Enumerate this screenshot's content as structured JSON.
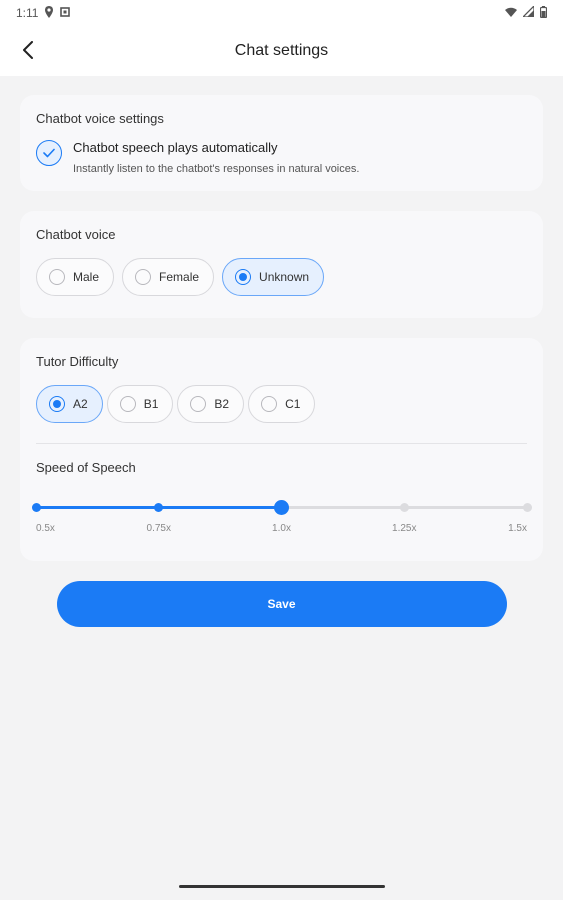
{
  "status_bar": {
    "time": "1:11",
    "icons": [
      "location-icon",
      "notification-icon",
      "wifi-icon",
      "signal-icon",
      "battery-icon"
    ]
  },
  "app_bar": {
    "title": "Chat settings",
    "back_icon": "back-arrow-icon"
  },
  "voice_settings_card": {
    "title": "Chatbot voice settings",
    "auto_play": {
      "checked": true,
      "label": "Chatbot speech plays automatically",
      "description": "Instantly listen to the chatbot's responses in natural voices."
    }
  },
  "voice_card": {
    "title": "Chatbot voice",
    "options": [
      {
        "label": "Male",
        "selected": false
      },
      {
        "label": "Female",
        "selected": false
      },
      {
        "label": "Unknown",
        "selected": true
      }
    ]
  },
  "difficulty_card": {
    "title": "Tutor Difficulty",
    "options": [
      {
        "label": "A2",
        "selected": true
      },
      {
        "label": "B1",
        "selected": false
      },
      {
        "label": "B2",
        "selected": false
      },
      {
        "label": "C1",
        "selected": false
      }
    ],
    "speed": {
      "title": "Speed of Speech",
      "labels": [
        "0.5x",
        "0.75x",
        "1.0x",
        "1.25x",
        "1.5x"
      ],
      "selected_index": 2
    }
  },
  "save_button": {
    "label": "Save"
  },
  "colors": {
    "accent": "#1b7bf5",
    "background": "#f3f3f4",
    "card": "#f8f8fa"
  }
}
